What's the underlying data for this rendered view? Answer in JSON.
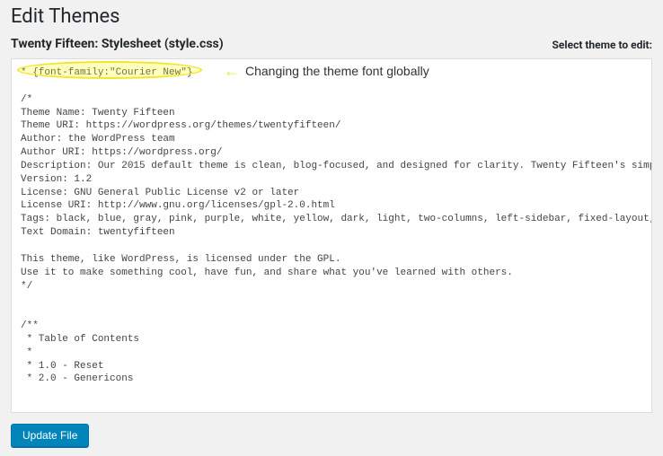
{
  "page_title": "Edit Themes",
  "subtitle": "Twenty Fifteen: Stylesheet (style.css)",
  "select_label": "Select theme to edit:",
  "annotation": {
    "text": "Changing the theme font globally"
  },
  "editor": {
    "content": "* {font-family:\"Courier New\"}\n\n/*\nTheme Name: Twenty Fifteen\nTheme URI: https://wordpress.org/themes/twentyfifteen/\nAuthor: the WordPress team\nAuthor URI: https://wordpress.org/\nDescription: Our 2015 default theme is clean, blog-focused, and designed for clarity. Twenty Fifteen's simple, straightforward typography is readable on a wide variety of screen sizes, and suitable for multiple languages. We designed it using a mobile-first approach, meaning your content takes center-stage, regardless of whether your visitors arrive by smartphone, tablet, laptop, or desktop computer.\nVersion: 1.2\nLicense: GNU General Public License v2 or later\nLicense URI: http://www.gnu.org/licenses/gpl-2.0.html\nTags: black, blue, gray, pink, purple, white, yellow, dark, light, two-columns, left-sidebar, fixed-layout, responsive-layout, accessibility-ready, custom-background, custom-colors, custom-header, custom-menu, editor-style, featured-images, microformats, post-formats, rtl-language-support, sticky-post, threaded-comments, translation-ready\nText Domain: twentyfifteen\n\nThis theme, like WordPress, is licensed under the GPL.\nUse it to make something cool, have fun, and share what you've learned with others.\n*/\n\n\n/**\n * Table of Contents\n *\n * 1.0 - Reset\n * 2.0 - Genericons"
  },
  "update_button": "Update File"
}
